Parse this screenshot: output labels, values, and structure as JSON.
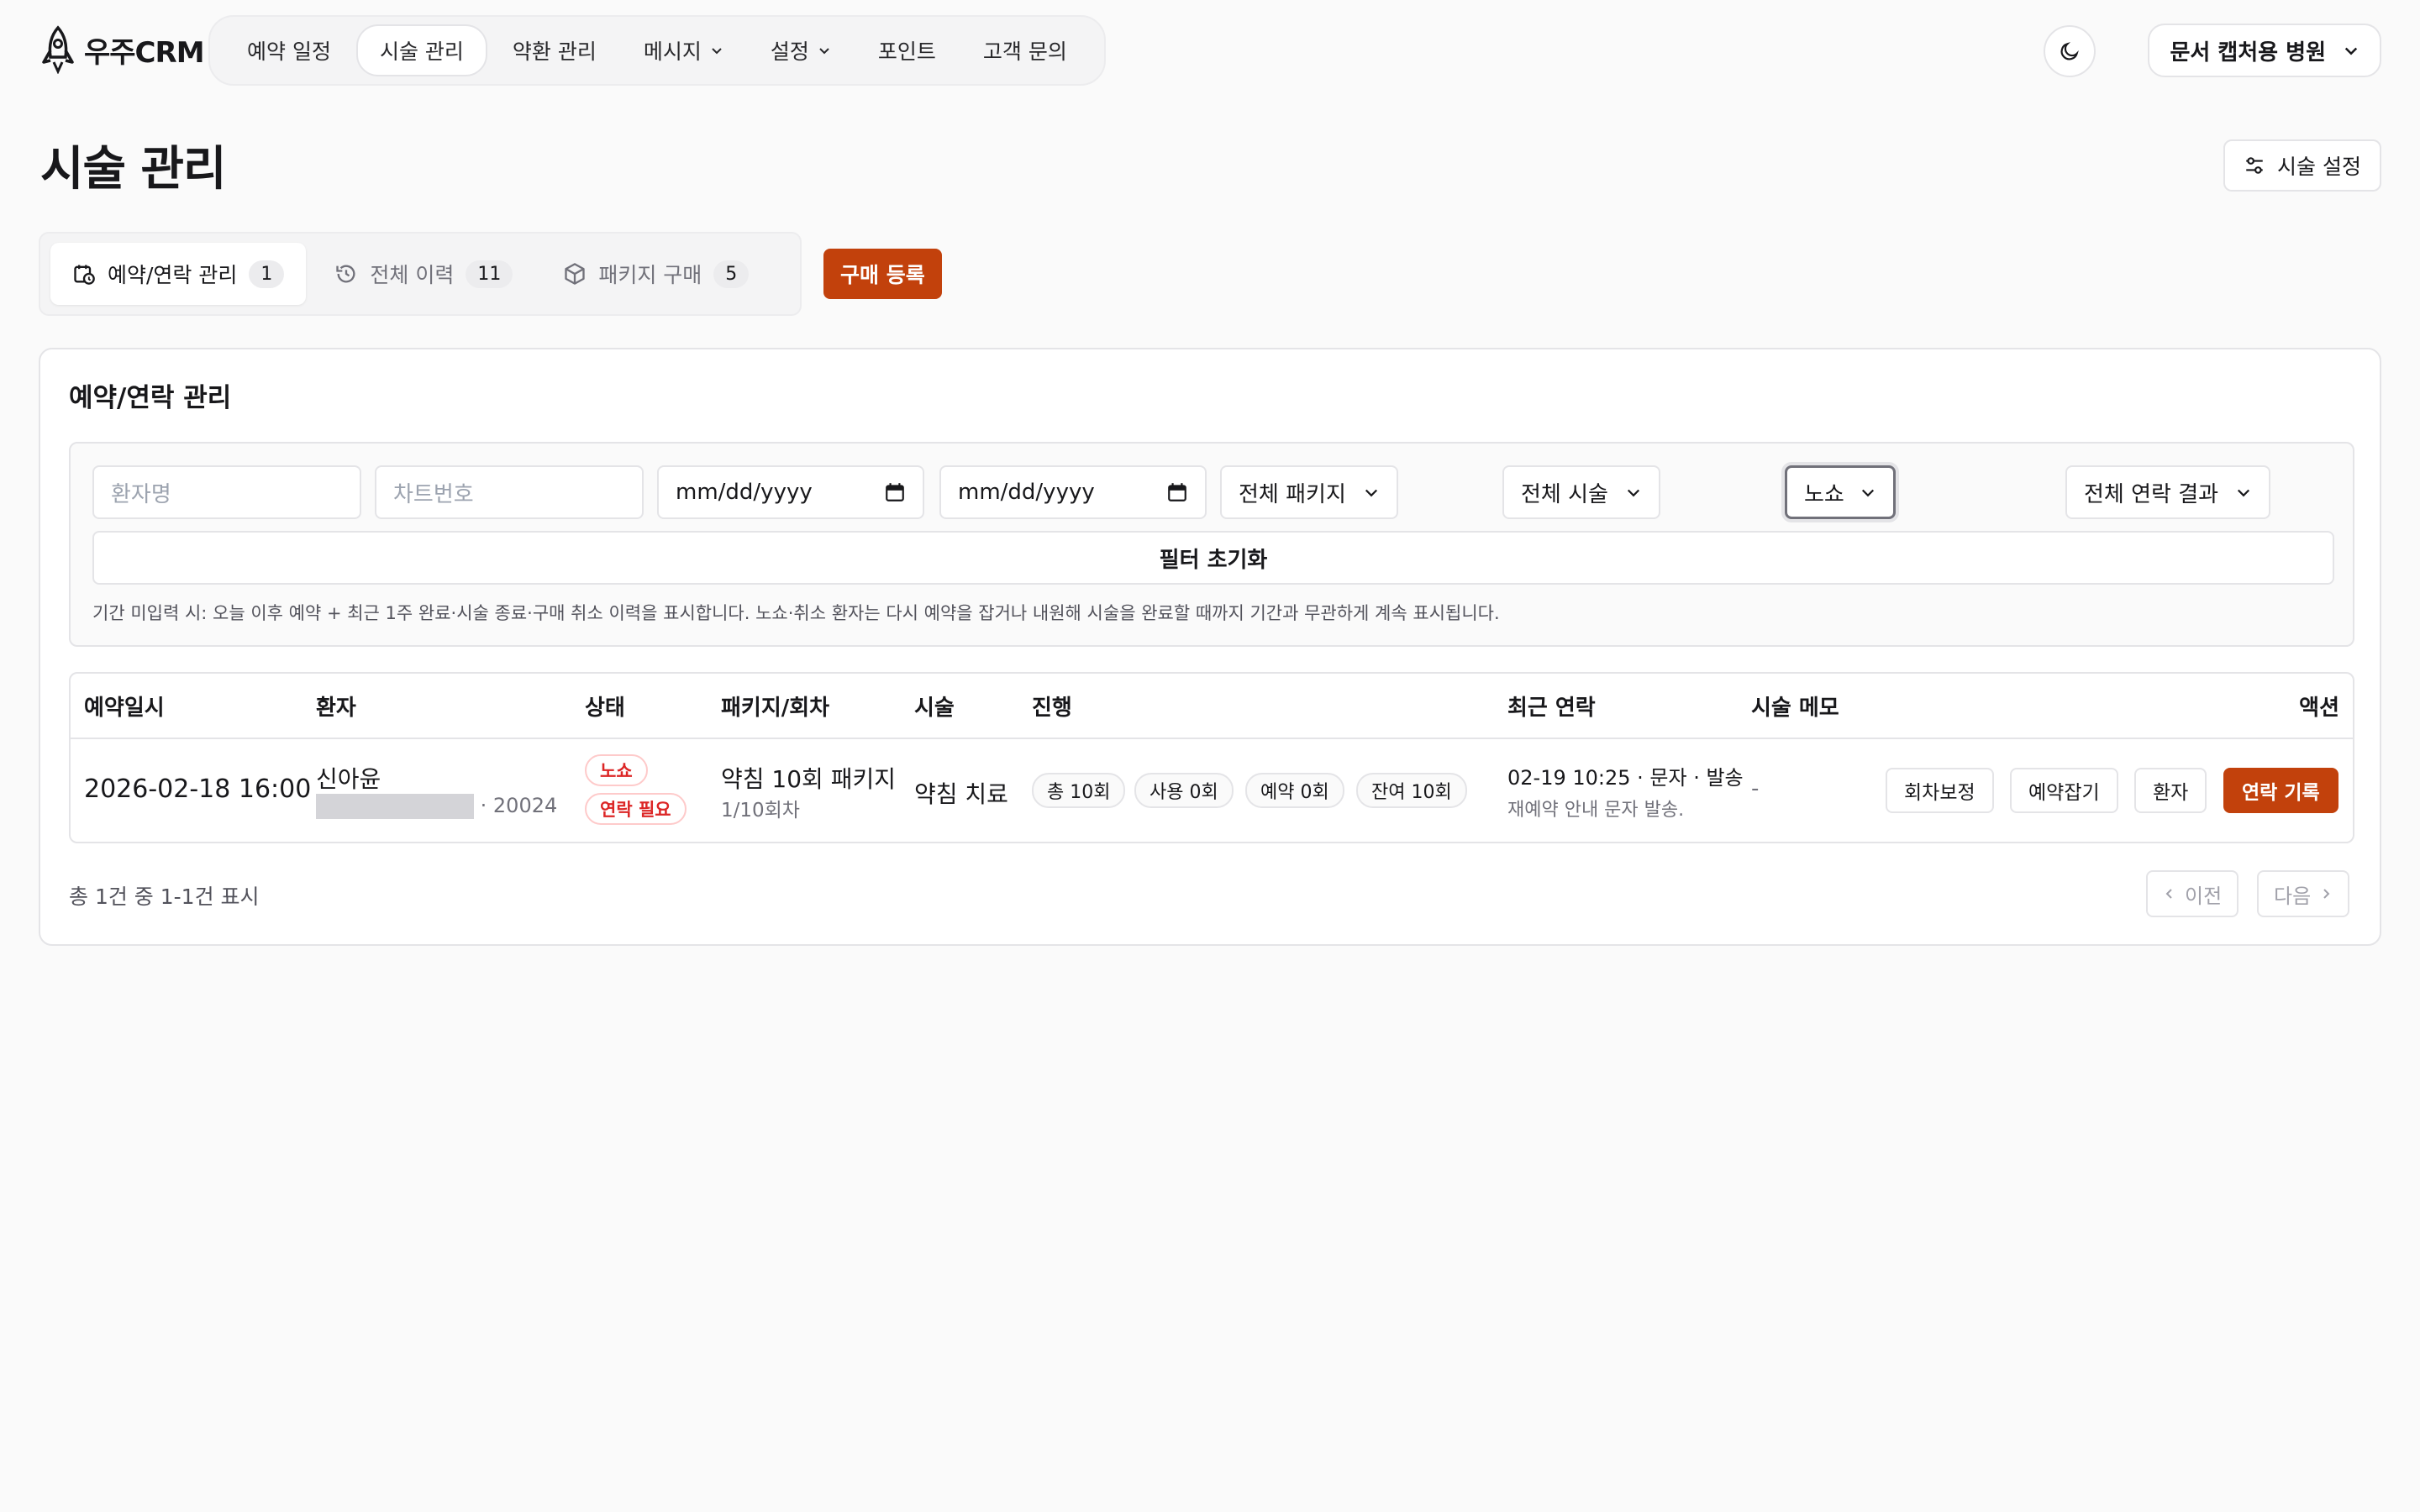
{
  "app": {
    "logo_text": "우주CRM"
  },
  "nav": {
    "items": [
      {
        "label": "예약 일정"
      },
      {
        "label": "시술 관리"
      },
      {
        "label": "약환 관리"
      },
      {
        "label": "메시지"
      },
      {
        "label": "설정"
      },
      {
        "label": "포인트"
      },
      {
        "label": "고객 문의"
      }
    ],
    "active_index": 1,
    "org_name": "문서 캡처용 병원"
  },
  "header": {
    "title": "시술 관리",
    "settings_label": "시술 설정"
  },
  "tabs": [
    {
      "label": "예약/연락 관리",
      "count": "1"
    },
    {
      "label": "전체 이력",
      "count": "11"
    },
    {
      "label": "패키지 구매",
      "count": "5"
    }
  ],
  "buy_button": "구매 등록",
  "section": {
    "title": "예약/연락 관리",
    "filters": {
      "patient_placeholder": "환자명",
      "chart_placeholder": "차트번호",
      "date_from": "mm/dd/yyyy",
      "date_to": "mm/dd/yyyy",
      "package": "전체 패키지",
      "procedure": "전체 시술",
      "status": "노쇼",
      "contact_result": "전체 연락 결과",
      "reset_label": "필터 초기화",
      "note": "기간 미입력 시: 오늘 이후 예약 + 최근 1주 완료·시술 종료·구매 취소 이력을 표시합니다. 노쇼·취소 환자는 다시 예약을 잡거나 내원해 시술을 완료할 때까지 기간과 무관하게 계속 표시됩니다."
    },
    "columns": [
      "예약일시",
      "환자",
      "상태",
      "패키지/회차",
      "시술",
      "진행",
      "최근 연락",
      "시술 메모",
      "액션"
    ],
    "rows": [
      {
        "datetime": "2026-02-18 16:00",
        "patient_name": "신아윤",
        "chart_suffix": "· 20024",
        "status_1": "노쇼",
        "status_2": "연락 필요",
        "package": "약침 10회 패키지",
        "session": "1/10회차",
        "procedure": "약침 치료",
        "progress": [
          "총 10회",
          "사용 0회",
          "예약 0회",
          "잔여 10회"
        ],
        "last_contact": "02-19 10:25 · 문자 · 발송",
        "last_contact_note": "재예약 안내 문자 발송.",
        "memo": "-",
        "actions": [
          "회차보정",
          "예약잡기",
          "환자",
          "연락 기록"
        ]
      }
    ],
    "summary": "총 1건 중 1-1건 표시",
    "pager": {
      "prev": "이전",
      "next": "다음"
    }
  },
  "colors": {
    "accent": "#c2410c",
    "danger": "#dc2626"
  }
}
